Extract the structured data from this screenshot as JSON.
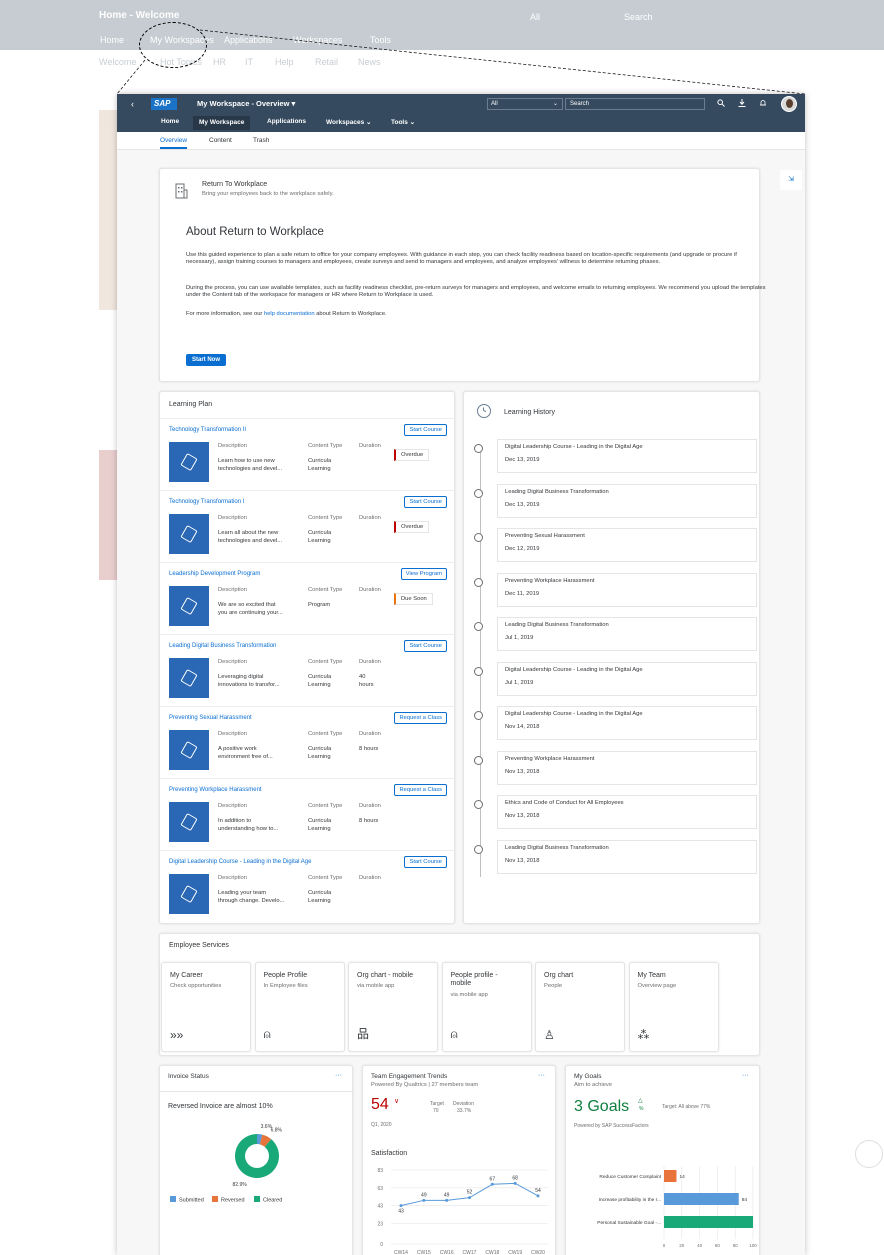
{
  "background": {
    "title": "Home - Welcome",
    "nav": [
      "Home",
      "My Workspaces",
      "Applications",
      "Workspaces",
      "Tools"
    ],
    "subtabs": [
      "Welcome",
      "Hot Topics",
      "HR",
      "IT",
      "Help",
      "Retail",
      "News"
    ],
    "search_value": "All",
    "search_placeholder": "Search"
  },
  "shell": {
    "back_icon": "‹",
    "logo": "SAP",
    "title": "My Workspace - Overview ▾",
    "select_value": "All",
    "search_placeholder": "Search",
    "icons": [
      "search-icon",
      "download-icon",
      "bell-icon",
      "avatar"
    ]
  },
  "tabs": [
    {
      "label": "Home"
    },
    {
      "label": "My Workspace"
    },
    {
      "label": "Applications"
    },
    {
      "label": "Workspaces ⌄"
    },
    {
      "label": "Tools ⌄"
    }
  ],
  "subtabs": [
    {
      "label": "Overview"
    },
    {
      "label": "Content"
    },
    {
      "label": "Trash"
    }
  ],
  "collapse_icon": "⇲",
  "return_to_workplace": {
    "header": "Return To Workplace",
    "subheader": "Bring your employees back to the workplace safely.",
    "title": "About Return to Workplace",
    "para1": "Use this guided experience to plan a safe return to office for your company employees. With guidance in each step, you can check facility readiness based on location-specific requirements (and upgrade or procure if necessary), assign training courses to managers and employees, create surveys and send to managers and employees, and analyze employees' willness to determine returning phases.",
    "para2": "During the process, you can use available templates, such as facility readiness checklist, pre-return surveys for managers and employees, and welcome emails to returning employees. We recommend you upload the templates under the Content tab of the workspace for managers or HR where Return to Workplace is used.",
    "para3_before": "For more information, see our ",
    "para3_link": "help documentation",
    "para3_after": " about Return to Workplace.",
    "button": "Start Now"
  },
  "learning_plan": {
    "title": "Learning Plan",
    "labels": {
      "description": "Description",
      "content_type": "Content Type",
      "duration": "Duration"
    },
    "items": [
      {
        "name": "Technology Transformation II",
        "action": "Start Course",
        "desc1": "Learn how to use new",
        "desc2": "technologies and devel...",
        "type1": "Curricula",
        "type2": "Learning",
        "duration": "",
        "status": "Overdue"
      },
      {
        "name": "Technology Transformation I",
        "action": "Start Course",
        "desc1": "Learn all about the new",
        "desc2": "technologies and devel...",
        "type1": "Curricula",
        "type2": "Learning",
        "duration": "",
        "status": "Overdue"
      },
      {
        "name": "Leadership Development Program",
        "action": "View Program",
        "desc1": "We are so excited that",
        "desc2": "you are continuing your...",
        "type1": "Program",
        "type2": "",
        "duration": "",
        "status": "Due Soon"
      },
      {
        "name": "Leading Digital Business Transformation",
        "action": "Start Course",
        "desc1": "Leveraging digital",
        "desc2": "innovations to transfor...",
        "type1": "Curricula",
        "type2": "Learning",
        "duration": "40",
        "duration2": "hours",
        "status": ""
      },
      {
        "name": "Preventing Sexual Harassment",
        "action": "Request a Class",
        "desc1": "A positive work",
        "desc2": "environment free of...",
        "type1": "Curricula",
        "type2": "Learning",
        "duration": "8 hours",
        "status": ""
      },
      {
        "name": "Preventing Workplace Harassment",
        "action": "Request a Class",
        "desc1": "In addition to",
        "desc2": "understanding how to...",
        "type1": "Curricula",
        "type2": "Learning",
        "duration": "8 hours",
        "status": ""
      },
      {
        "name": "Digital Leadership Course - Leading in the Digital Age",
        "action": "Start Course",
        "desc1": "Leading your team",
        "desc2": "through change. Develo...",
        "type1": "Curricula",
        "type2": "Learning",
        "duration": "",
        "status": ""
      }
    ]
  },
  "learning_history": {
    "title": "Learning History",
    "items": [
      {
        "name": "Digital Leadership Course - Leading in the Digital Age",
        "date": "Dec 13, 2019"
      },
      {
        "name": "Leading Digital Business Transformation",
        "date": "Dec 13, 2019"
      },
      {
        "name": "Preventing Sexual Harassment",
        "date": "Dec 12, 2019"
      },
      {
        "name": "Preventing Workplace Harassment",
        "date": "Dec 11, 2019"
      },
      {
        "name": "Leading Digital Business Transformation",
        "date": "Jul 1, 2019"
      },
      {
        "name": "Digital Leadership Course - Leading in the Digital Age",
        "date": "Jul 1, 2019"
      },
      {
        "name": "Digital Leadership Course - Leading in the Digital Age",
        "date": "Nov 14, 2018"
      },
      {
        "name": "Preventing Workplace Harassment",
        "date": "Nov 13, 2018"
      },
      {
        "name": "Ethics and Code of Conduct for All Employees",
        "date": "Nov 13, 2018"
      },
      {
        "name": "Leading Digital Business Transformation",
        "date": "Nov 13, 2018"
      }
    ]
  },
  "employee_services": {
    "title": "Employee Services",
    "tiles": [
      {
        "title": "My Career",
        "title2": "",
        "sub": "Check opportunities",
        "icon": "»»"
      },
      {
        "title": "People Profile",
        "title2": "",
        "sub": "In Employee files",
        "icon": "⍝"
      },
      {
        "title": "Org chart - mobile",
        "title2": "",
        "sub": "via mobile app",
        "icon": "品"
      },
      {
        "title": "People profile -",
        "title2": "mobile",
        "sub": "via mobile app",
        "icon": "⍝"
      },
      {
        "title": "Org chart",
        "title2": "",
        "sub": "People",
        "icon": "♙"
      },
      {
        "title": "My Team",
        "title2": "",
        "sub": "Overview page",
        "icon": "⁂"
      }
    ]
  },
  "invoice_status": {
    "title": "Invoice Status",
    "more": "···",
    "subtitle": "Reversed Invoice are almost 10%"
  },
  "team_engagement": {
    "title": "Team Engagement Trends",
    "subtitle": "Powered By Qualtrics | 27 members team",
    "value": "54",
    "arrow": "∨",
    "target_label": "Target",
    "target_value": "70",
    "deviation_label": "Deviation",
    "deviation_value": "33.7%",
    "period": "Q1, 2020",
    "chart_title": "Satisfaction",
    "more": "···"
  },
  "my_goals": {
    "title": "My Goals",
    "subtitle": "Aim to achieve",
    "value": "3 Goals",
    "arrow": "△",
    "pct": "%",
    "target": "Target: All above 77%",
    "powered": "Powered by SAP SuccessFactors",
    "more": "···"
  },
  "chart_data": [
    {
      "type": "pie",
      "categories": [
        "Submitted",
        "Reversed",
        "Cleared"
      ],
      "values": [
        3.6,
        6.8,
        82.9
      ],
      "data_labels": [
        "3.6%",
        "6.8%",
        "82.9%"
      ],
      "legend": "bottom",
      "colors": [
        "#5899da",
        "#e8743b",
        "#19a979"
      ]
    },
    {
      "type": "line",
      "title": "Satisfaction",
      "categories": [
        "CW14",
        "CW15",
        "CW16",
        "CW17",
        "CW18",
        "CW19",
        "CW20"
      ],
      "series": [
        {
          "values": [
            43,
            49,
            49,
            52,
            67,
            68,
            54
          ]
        }
      ],
      "data_labels": [
        "43",
        "49",
        "49",
        "52",
        "67",
        "68",
        "54"
      ],
      "yticks": [
        "0",
        "23",
        "43",
        "63",
        "83"
      ],
      "ylim": [
        0,
        83
      ],
      "grid": true,
      "color": "#5899da"
    },
    {
      "type": "bar",
      "orientation": "horizontal",
      "categories": [
        "Reduce Customer Complaint",
        "Increase profitability in the r...",
        "Personal Sustainable Goal -..."
      ],
      "values": [
        14,
        84,
        100
      ],
      "data_labels": [
        "14",
        "84",
        ""
      ],
      "colors": [
        "#e8743b",
        "#5899da",
        "#19a979"
      ],
      "xticks": [
        "0",
        "20",
        "40",
        "60",
        "80",
        "100"
      ],
      "xlim": [
        0,
        100
      ]
    }
  ]
}
